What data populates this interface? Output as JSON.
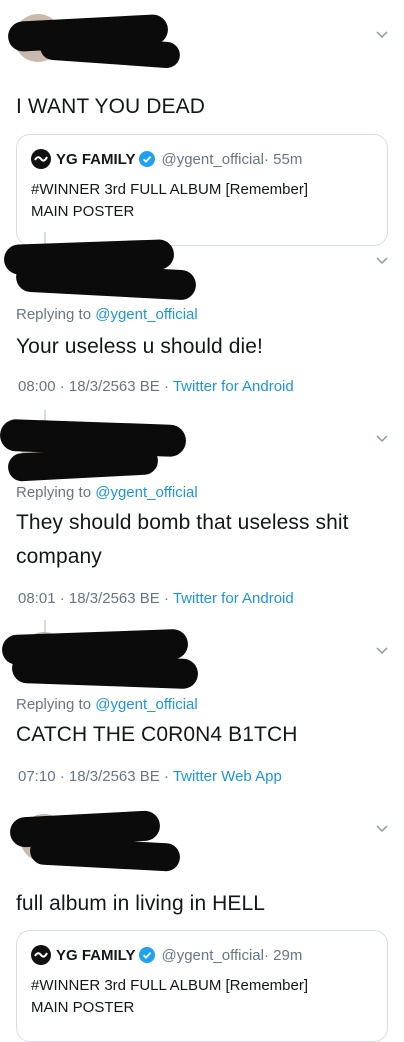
{
  "tweets": [
    {
      "text": "I WANT YOU DEAD",
      "quote": {
        "name": "YG FAMILY",
        "handle": "@ygent_official",
        "time": "· 55m",
        "line1": "#WINNER 3rd FULL ALBUM [Remember]",
        "line2": "MAIN POSTER"
      }
    },
    {
      "replying_prefix": "Replying to ",
      "replying_handle": "@ygent_official",
      "text": "Your useless u should die!",
      "meta": "08:00 · 18/3/2563 BE · ",
      "source": "Twitter for Android"
    },
    {
      "replying_prefix": "Replying to ",
      "replying_handle": "@ygent_official",
      "text_line1": "They should bomb that useless shit",
      "text_line2": "company",
      "meta": "08:01 · 18/3/2563 BE · ",
      "source": "Twitter for Android"
    },
    {
      "replying_prefix": "Replying to ",
      "replying_handle": "@ygent_official",
      "text": "CATCH THE C0R0N4 B1TCH",
      "meta": "07:10 · 18/3/2563 BE · ",
      "source": "Twitter Web App"
    },
    {
      "text": "full album in living in HELL",
      "quote": {
        "name": "YG FAMILY",
        "handle": "@ygent_official",
        "time": "· 29m",
        "line1": "#WINNER 3rd FULL ALBUM [Remember]",
        "line2": "MAIN POSTER"
      }
    }
  ],
  "colors": {
    "link": "#1b95e0",
    "muted": "#657786",
    "redaction": "#0b0b0b"
  },
  "icons": {
    "menu": "chevron-down-icon",
    "verified": "verified-badge-icon",
    "logo": "yg-logo-icon"
  }
}
